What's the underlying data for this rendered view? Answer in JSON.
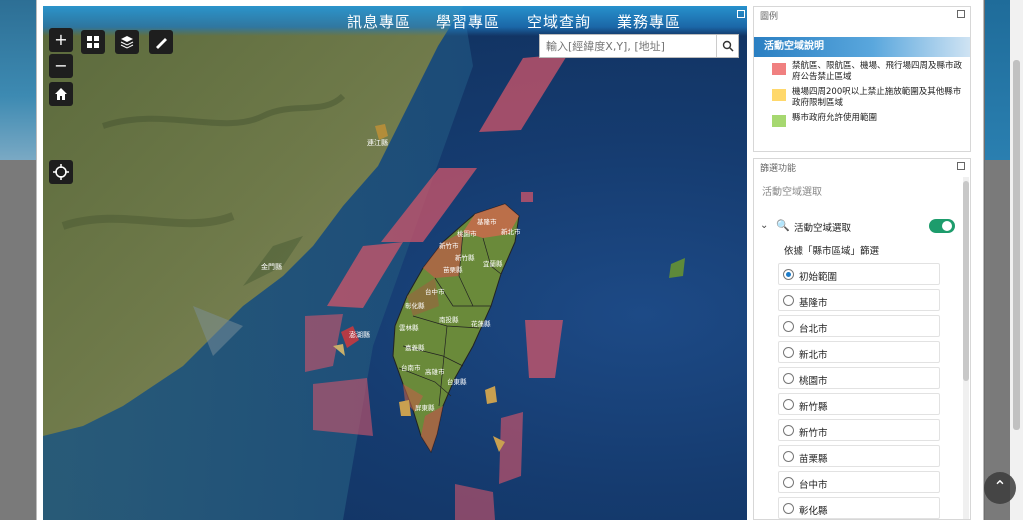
{
  "nav": {
    "items": [
      "訊息專區",
      "學習專區",
      "空域查詢",
      "業務專區"
    ]
  },
  "map": {
    "search_placeholder": "輸入[經緯度X,Y], [地址]",
    "labels": {
      "lianjiang": "連江縣",
      "kinmen": "金門縣",
      "penghu": "澎湖縣",
      "keelung": "基隆市",
      "taipei": "台北市",
      "newtaipei": "新北市",
      "taoyuan": "桃園市",
      "hsinchu_city": "新竹市",
      "hsinchu_county": "新竹縣",
      "miaoli": "苗栗縣",
      "yilan": "宜蘭縣",
      "taichung": "台中市",
      "changhua": "彰化縣",
      "nantou": "南投縣",
      "yunlin": "雲林縣",
      "hualien": "花蓮縣",
      "chiayi": "嘉義縣",
      "tainan": "台南市",
      "kaohsiung": "高雄市",
      "taitung": "台東縣",
      "pingtung": "屏東縣"
    }
  },
  "legend": {
    "header": "圖例",
    "title": "活動空域說明",
    "items": [
      {
        "color": "#f08080",
        "text": "禁航區、限航區、機場、飛行場四周及縣市政府公告禁止區域"
      },
      {
        "color": "#ffd86b",
        "text": "機場四周200呎以上禁止施放範圍及其他縣市政府限制區域"
      },
      {
        "color": "#a6d870",
        "text": "縣市政府允許使用範圍"
      }
    ]
  },
  "filter": {
    "header": "篩選功能",
    "subtitle": "活動空域選取",
    "row_label": "活動空域選取",
    "by_label": "依據「縣市區域」篩選",
    "options": [
      "初始範圍",
      "基隆市",
      "台北市",
      "新北市",
      "桃園市",
      "新竹縣",
      "新竹市",
      "苗栗縣",
      "台中市",
      "彰化縣"
    ],
    "selected_index": 0
  }
}
